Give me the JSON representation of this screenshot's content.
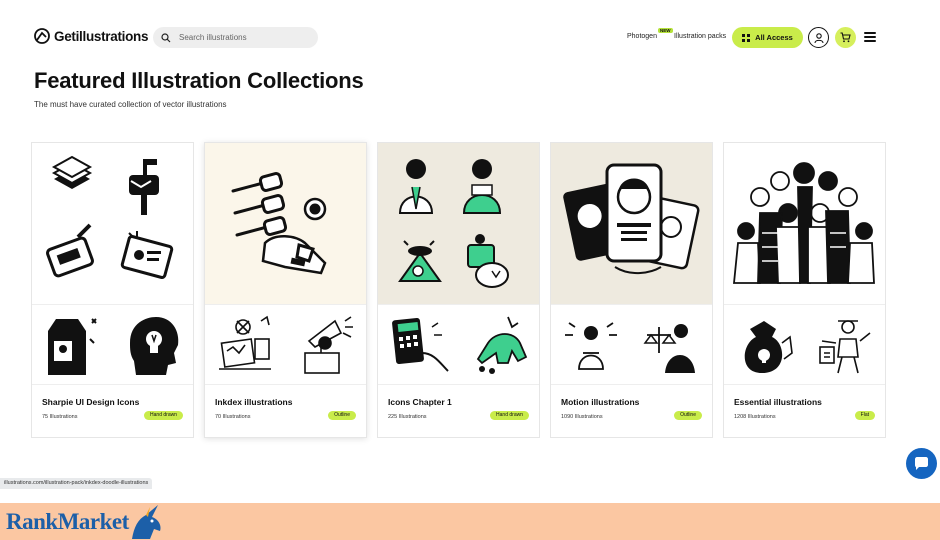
{
  "header": {
    "logo_text": "Getillustrations",
    "search_placeholder": "Search illustrations",
    "nav_photogen": "Photogen",
    "photogen_badge": "NEW",
    "nav_packs": "Illustration packs",
    "all_access_label": "All Access"
  },
  "page": {
    "title": "Featured Illustration Collections",
    "subtitle": "The must have curated collection of vector illustrations"
  },
  "cards": [
    {
      "name": "Sharpie UI Design Icons",
      "count": "75 Illustrations",
      "tag": "Hand drawn",
      "hero_bg": "#ffffff"
    },
    {
      "name": "Inkdex illustrations",
      "count": "70 Illustrations",
      "tag": "Outline",
      "hero_bg": "#fbf6ea"
    },
    {
      "name": "Icons Chapter 1",
      "count": "225 Illustrations",
      "tag": "Hand drawn",
      "hero_bg": "#eeeadf"
    },
    {
      "name": "Motion illustrations",
      "count": "1090 Illustrations",
      "tag": "Outline",
      "hero_bg": "#eeeadf"
    },
    {
      "name": "Essential illustrations",
      "count": "1208 Illustrations",
      "tag": "Flat",
      "hero_bg": "#ffffff"
    }
  ],
  "status_url": "illustrations.com/illustration-pack/inkdex-doodle-illustrations",
  "banner": {
    "logo_part1": "Rank",
    "logo_part2": "Market"
  },
  "colors": {
    "accent": "#c9ec4a",
    "accent_green": "#3ecf8e",
    "chat_blue": "#1565c0",
    "banner_bg": "#fbc7a2",
    "brand_blue": "#1c5fa8"
  }
}
